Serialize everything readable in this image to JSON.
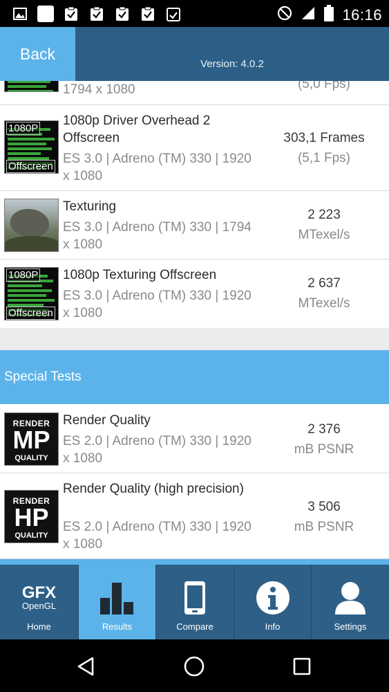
{
  "status_bar": {
    "time": "16:16",
    "left_icons": [
      "image-icon",
      "app-square-icon",
      "clipboard-check-icon",
      "clipboard-check-icon",
      "clipboard-check-icon",
      "clipboard-check-icon",
      "clipboard-list-icon"
    ],
    "right_icons": [
      "do-not-disturb-icon",
      "signal-icon",
      "battery-icon"
    ]
  },
  "header": {
    "back_label": "Back",
    "version": "Version: 4.0.2"
  },
  "list": {
    "partial_row": {
      "sub": "1794 x 1080",
      "unit": "(5,0 Fps)"
    },
    "rows": [
      {
        "title": "1080p Driver Overhead 2 Offscreen",
        "sub": "ES 3.0 | Adreno (TM) 330 | 1920 x 1080",
        "score": "303,1 Frames",
        "unit": "(5,1 Fps)",
        "thumb_tag": [
          "1080P",
          "Offscreen"
        ]
      },
      {
        "title": "Texturing",
        "sub": "ES 3.0 | Adreno (TM) 330 | 1794 x 1080",
        "score": "2 223",
        "unit": "MTexel/s"
      },
      {
        "title": "1080p Texturing Offscreen",
        "sub": "ES 3.0 | Adreno (TM) 330 | 1920 x 1080",
        "score": "2 637",
        "unit": "MTexel/s",
        "thumb_tag": [
          "1080P",
          "Offscreen"
        ]
      }
    ],
    "section_title": "Special Tests",
    "special_rows": [
      {
        "title": "Render Quality",
        "sub": "ES 2.0 | Adreno (TM) 330 | 1920 x 1080",
        "score": "2 376",
        "unit": "mB PSNR",
        "badge": {
          "top": "RENDER",
          "big": "MP",
          "bottom": "QUALITY"
        }
      },
      {
        "title": "Render Quality (high precision)",
        "sub": "ES 2.0 | Adreno (TM) 330 | 1920 x 1080",
        "score": "3 506",
        "unit": "mB PSNR",
        "badge": {
          "top": "RENDER",
          "big": "HP",
          "bottom": "QUALITY"
        }
      }
    ]
  },
  "nav": {
    "items": [
      {
        "label": "Home",
        "icon": "gfx-opengl-logo",
        "logo_word": "GFX",
        "logo_sub": "OpenGL"
      },
      {
        "label": "Results",
        "icon": "bar-chart-icon",
        "active": true
      },
      {
        "label": "Compare",
        "icon": "phone-icon"
      },
      {
        "label": "Info",
        "icon": "info-icon"
      },
      {
        "label": "Settings",
        "icon": "user-icon"
      }
    ]
  },
  "system_nav": [
    "back-triangle-icon",
    "home-circle-icon",
    "recents-square-icon"
  ],
  "colors": {
    "header_bg": "#2d5f86",
    "accent": "#5cb3ea",
    "nav_bg": "#2e5f87"
  }
}
